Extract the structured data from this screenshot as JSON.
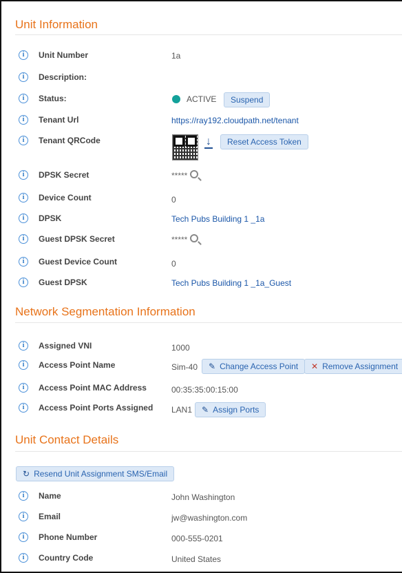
{
  "unit_info": {
    "title": "Unit Information",
    "unit_number": {
      "label": "Unit Number",
      "value": "1a"
    },
    "description": {
      "label": "Description:",
      "value": ""
    },
    "status": {
      "label": "Status:",
      "value": "ACTIVE",
      "action": "Suspend",
      "color": "#13a19a"
    },
    "tenant_url": {
      "label": "Tenant Url",
      "value": "https://ray192.cloudpath.net/tenant"
    },
    "tenant_qrcode": {
      "label": "Tenant QRCode",
      "action": "Reset Access Token",
      "icon": "download-icon"
    },
    "dpsk_secret": {
      "label": "DPSK Secret",
      "value": "*****",
      "icon": "search-icon"
    },
    "device_count": {
      "label": "Device Count",
      "value": "0"
    },
    "dpsk": {
      "label": "DPSK",
      "value": "Tech Pubs Building 1 _1a"
    },
    "guest_dpsk_secret": {
      "label": "Guest DPSK Secret",
      "value": "*****",
      "icon": "search-icon"
    },
    "guest_device_count": {
      "label": "Guest Device Count",
      "value": "0"
    },
    "guest_dpsk": {
      "label": "Guest DPSK",
      "value": "Tech Pubs Building 1 _1a_Guest"
    }
  },
  "network": {
    "title": "Network Segmentation Information",
    "assigned_vni": {
      "label": "Assigned VNI",
      "value": "1000"
    },
    "ap_name": {
      "label": "Access Point Name",
      "value": "Sim-40",
      "change": "Change Access Point",
      "remove": "Remove Assignment"
    },
    "ap_mac": {
      "label": "Access Point MAC Address",
      "value": "00:35:35:00:15:00"
    },
    "ap_ports": {
      "label": "Access Point Ports Assigned",
      "value": "LAN1",
      "action": "Assign Ports"
    }
  },
  "contact": {
    "title": "Unit Contact Details",
    "resend": "Resend Unit Assignment SMS/Email",
    "name": {
      "label": "Name",
      "value": "John Washington"
    },
    "email": {
      "label": "Email",
      "value": "jw@washington.com"
    },
    "phone": {
      "label": "Phone Number",
      "value": "000-555-0201"
    },
    "country": {
      "label": "Country Code",
      "value": "United States"
    }
  },
  "colors": {
    "accent": "#e8731a",
    "link": "#1a56a8",
    "button_bg": "#dde9f7",
    "info_icon": "#2b78c5"
  }
}
